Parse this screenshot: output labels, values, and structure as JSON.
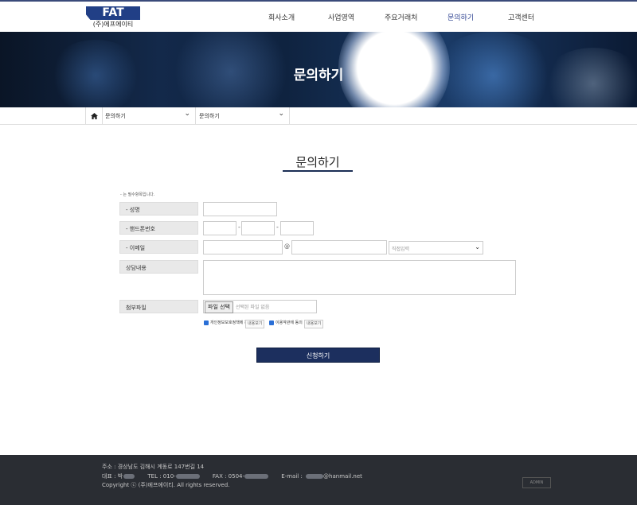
{
  "header": {
    "logo_mark": "FAT",
    "logo_sub": "(주)에프에이티",
    "nav": [
      "회사소개",
      "사업영역",
      "주요거래처",
      "문의하기",
      "고객센터"
    ],
    "active_nav": "문의하기"
  },
  "banner": {
    "title": "문의하기"
  },
  "breadcrumb": {
    "level1": "문의하기",
    "level2": "문의하기"
  },
  "page": {
    "title": "문의하기",
    "required_note": "- 는 필수항목입니다."
  },
  "form": {
    "name_label": "- 성명",
    "phone_label": "- 핸드폰번호",
    "phone_dash": "-",
    "email_label": "- 이메일",
    "email_at": "@",
    "email_domain_select": "직접입력",
    "content_label": "상담내용",
    "file_label": "첨부파일",
    "file_button": "파일 선택",
    "file_placeholder": "선택된 파일 없음",
    "agree_privacy": "개인정보보호정책에 동의",
    "agree_terms": "이용약관에 동의",
    "view_button": "내용보기",
    "submit": "신청하기"
  },
  "footer": {
    "address": "주소 : 경상남도 김해시 계동로 147번길 14",
    "rep_label": "대표 : 박",
    "tel_label": "TEL : 010-",
    "fax_label": "FAX : 0504-",
    "email_label": "E-mail :",
    "email_domain": "@hanmail.net",
    "copyright": "Copyright ⓒ (주)에프에이티. All rights reserved.",
    "admin": "ADMIN"
  },
  "colors": {
    "brand": "#213f86",
    "submit": "#1c2f5e",
    "footer_bg": "#2a2d33"
  },
  "icons": [
    "home-icon",
    "chevron-down-icon",
    "checkbox-checked-icon"
  ]
}
